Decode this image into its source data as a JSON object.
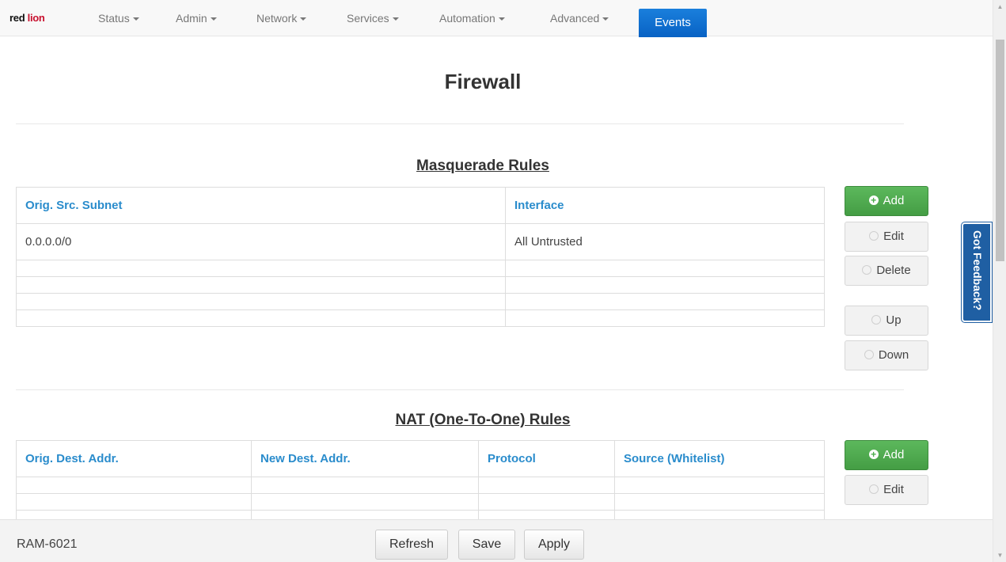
{
  "brand": {
    "logo_text_red": "red",
    "logo_text_lion": "lion"
  },
  "nav": {
    "items": [
      {
        "label": "Status"
      },
      {
        "label": "Admin"
      },
      {
        "label": "Network"
      },
      {
        "label": "Services"
      },
      {
        "label": "Automation"
      },
      {
        "label": "Advanced"
      }
    ],
    "events_label": "Events"
  },
  "page": {
    "title": "Firewall"
  },
  "masquerade": {
    "title": "Masquerade Rules",
    "columns": [
      "Orig. Src. Subnet",
      "Interface"
    ],
    "rows": [
      [
        "0.0.0.0/0",
        "All Untrusted"
      ]
    ],
    "buttons": {
      "add": "Add",
      "edit": "Edit",
      "delete": "Delete",
      "up": "Up",
      "down": "Down"
    }
  },
  "nat": {
    "title": "NAT (One-To-One) Rules",
    "columns": [
      "Orig. Dest. Addr.",
      "New Dest. Addr.",
      "Protocol",
      "Source (Whitelist)"
    ],
    "buttons": {
      "add": "Add",
      "edit": "Edit"
    }
  },
  "feedback": {
    "label": "Got Feedback?"
  },
  "footer": {
    "device": "RAM-6021",
    "refresh": "Refresh",
    "save": "Save",
    "apply": "Apply"
  },
  "colors": {
    "accent_blue": "#0a6ed1",
    "header_link": "#2a8ccc",
    "add_green": "#5cb85c",
    "feedback_blue": "#1f5fa3"
  }
}
